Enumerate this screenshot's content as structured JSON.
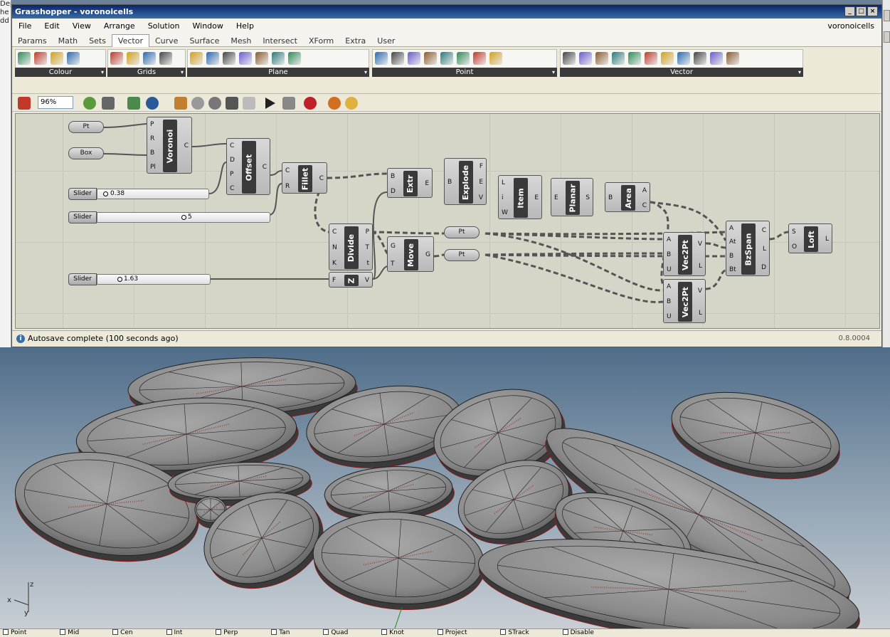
{
  "app": {
    "title": "Grasshopper - voronoicells",
    "document_name": "voronoicells",
    "version": "0.8.0004",
    "status_message": "Autosave complete (100 seconds ago)",
    "zoom": "96%"
  },
  "left_edge_text": [
    "Deple",
    "he",
    "dd"
  ],
  "menu": [
    "File",
    "Edit",
    "View",
    "Arrange",
    "Solution",
    "Window",
    "Help"
  ],
  "tabs": [
    {
      "label": "Params",
      "active": false
    },
    {
      "label": "Math",
      "active": false
    },
    {
      "label": "Sets",
      "active": false
    },
    {
      "label": "Vector",
      "active": true
    },
    {
      "label": "Curve",
      "active": false
    },
    {
      "label": "Surface",
      "active": false
    },
    {
      "label": "Mesh",
      "active": false
    },
    {
      "label": "Intersect",
      "active": false
    },
    {
      "label": "XForm",
      "active": false
    },
    {
      "label": "Extra",
      "active": false
    },
    {
      "label": "User",
      "active": false
    }
  ],
  "ribbon_groups": [
    {
      "label": "Colour",
      "icons": [
        "colour-swatch-icon",
        "colour-sphere-icon",
        "colour-mix-icon",
        "colour-blend-icon"
      ]
    },
    {
      "label": "Grids",
      "icons": [
        "square-grid-icon",
        "hex-grid-icon",
        "rect-grid-icon",
        "radial-grid-icon"
      ]
    },
    {
      "label": "Plane",
      "icons": [
        "xy-plane-icon",
        "plane-pt-icon",
        "plane-frame-icon",
        "plane-origin-icon",
        "plane-offset-icon",
        "plane-align-icon",
        "plane-normal-icon"
      ]
    },
    {
      "label": "Point",
      "icons": [
        "decompose-point-icon",
        "compose-point-icon",
        "point-ruler-icon",
        "point-project-icon",
        "point-cloud-icon",
        "point-pull-icon",
        "point-sort-icon",
        "point-tag-icon"
      ]
    },
    {
      "label": "Vector",
      "icons": [
        "vector-xyz-icon",
        "vector-decompose-icon",
        "vector-2pt-icon",
        "unit-x-icon",
        "unit-y-icon",
        "unit-z-icon",
        "vector-amplitude-icon",
        "vector-reverse-icon",
        "vector-angle-icon",
        "vector-length-icon",
        "vector-display-icon"
      ]
    }
  ],
  "toolbar_icons": [
    "brush-icon",
    "zoom-icon",
    "zoom-extents-icon",
    "map-icon",
    "eye-icon",
    "sketch-icon",
    "bake-icon",
    "shade-icon",
    "preview-icon",
    "wire-icon",
    "solve-icon",
    "lock-icon",
    "record-icon",
    "sphere-preview-icon",
    "bulb-icon"
  ],
  "canvas": {
    "params": [
      {
        "id": "pt1",
        "label": "Pt"
      },
      {
        "id": "box",
        "label": "Box"
      },
      {
        "id": "pt2",
        "label": "Pt"
      },
      {
        "id": "pt3",
        "label": "Pt"
      }
    ],
    "sliders": [
      {
        "id": "s1",
        "label": "Slider",
        "value": "0.38"
      },
      {
        "id": "s2",
        "label": "Slider",
        "value": "5"
      },
      {
        "id": "s3",
        "label": "Slider",
        "value": "1.63"
      }
    ],
    "components": [
      {
        "id": "voronoi",
        "name": "Voronoi",
        "inputs": [
          "P",
          "R",
          "B",
          "Pl"
        ],
        "outputs": [
          "C"
        ]
      },
      {
        "id": "offset",
        "name": "Offset",
        "inputs": [
          "C",
          "D",
          "P",
          "C"
        ],
        "outputs": [
          "C"
        ]
      },
      {
        "id": "fillet",
        "name": "Fillet",
        "inputs": [
          "C",
          "R"
        ],
        "outputs": [
          "C"
        ]
      },
      {
        "id": "divide",
        "name": "Divide",
        "inputs": [
          "C",
          "N",
          "K"
        ],
        "outputs": [
          "P",
          "T",
          "t"
        ]
      },
      {
        "id": "z",
        "name": "Z",
        "inputs": [
          "F"
        ],
        "outputs": [
          "V"
        ]
      },
      {
        "id": "extr",
        "name": "Extr",
        "inputs": [
          "B",
          "D"
        ],
        "outputs": [
          "E"
        ]
      },
      {
        "id": "move",
        "name": "Move",
        "inputs": [
          "G",
          "T"
        ],
        "outputs": [
          "G"
        ]
      },
      {
        "id": "explode",
        "name": "Explode",
        "inputs": [
          "B"
        ],
        "outputs": [
          "F",
          "E",
          "V"
        ]
      },
      {
        "id": "item",
        "name": "Item",
        "inputs": [
          "L",
          "i",
          "W"
        ],
        "outputs": [
          "E"
        ]
      },
      {
        "id": "planar",
        "name": "Planar",
        "inputs": [
          "E"
        ],
        "outputs": [
          "S"
        ]
      },
      {
        "id": "area",
        "name": "Area",
        "inputs": [
          "B"
        ],
        "outputs": [
          "A",
          "C"
        ]
      },
      {
        "id": "vec2pt1",
        "name": "Vec2Pt",
        "inputs": [
          "A",
          "B",
          "U"
        ],
        "outputs": [
          "V",
          "L"
        ]
      },
      {
        "id": "vec2pt2",
        "name": "Vec2Pt",
        "inputs": [
          "A",
          "B",
          "U"
        ],
        "outputs": [
          "V",
          "L"
        ]
      },
      {
        "id": "bzspan",
        "name": "BzSpan",
        "inputs": [
          "A",
          "At",
          "B",
          "Bt"
        ],
        "outputs": [
          "C",
          "L",
          "D"
        ]
      },
      {
        "id": "loft",
        "name": "Loft",
        "inputs": [
          "S",
          "O"
        ],
        "outputs": [
          "L"
        ]
      }
    ]
  },
  "rhino_status": [
    "Point",
    "Mid",
    "Cen",
    "Int",
    "Perp",
    "Tan",
    "Quad",
    "Knot",
    "Project",
    "STrack",
    "Disable"
  ],
  "axis_labels": {
    "z": "z",
    "x": "x",
    "y": "y"
  },
  "colors": {
    "title_bar": "#0a246a",
    "canvas": "#d5d5c8",
    "component": "#3a3a3a",
    "stone": "#8a8a8a",
    "stone_edge": "#8c1a1a"
  }
}
